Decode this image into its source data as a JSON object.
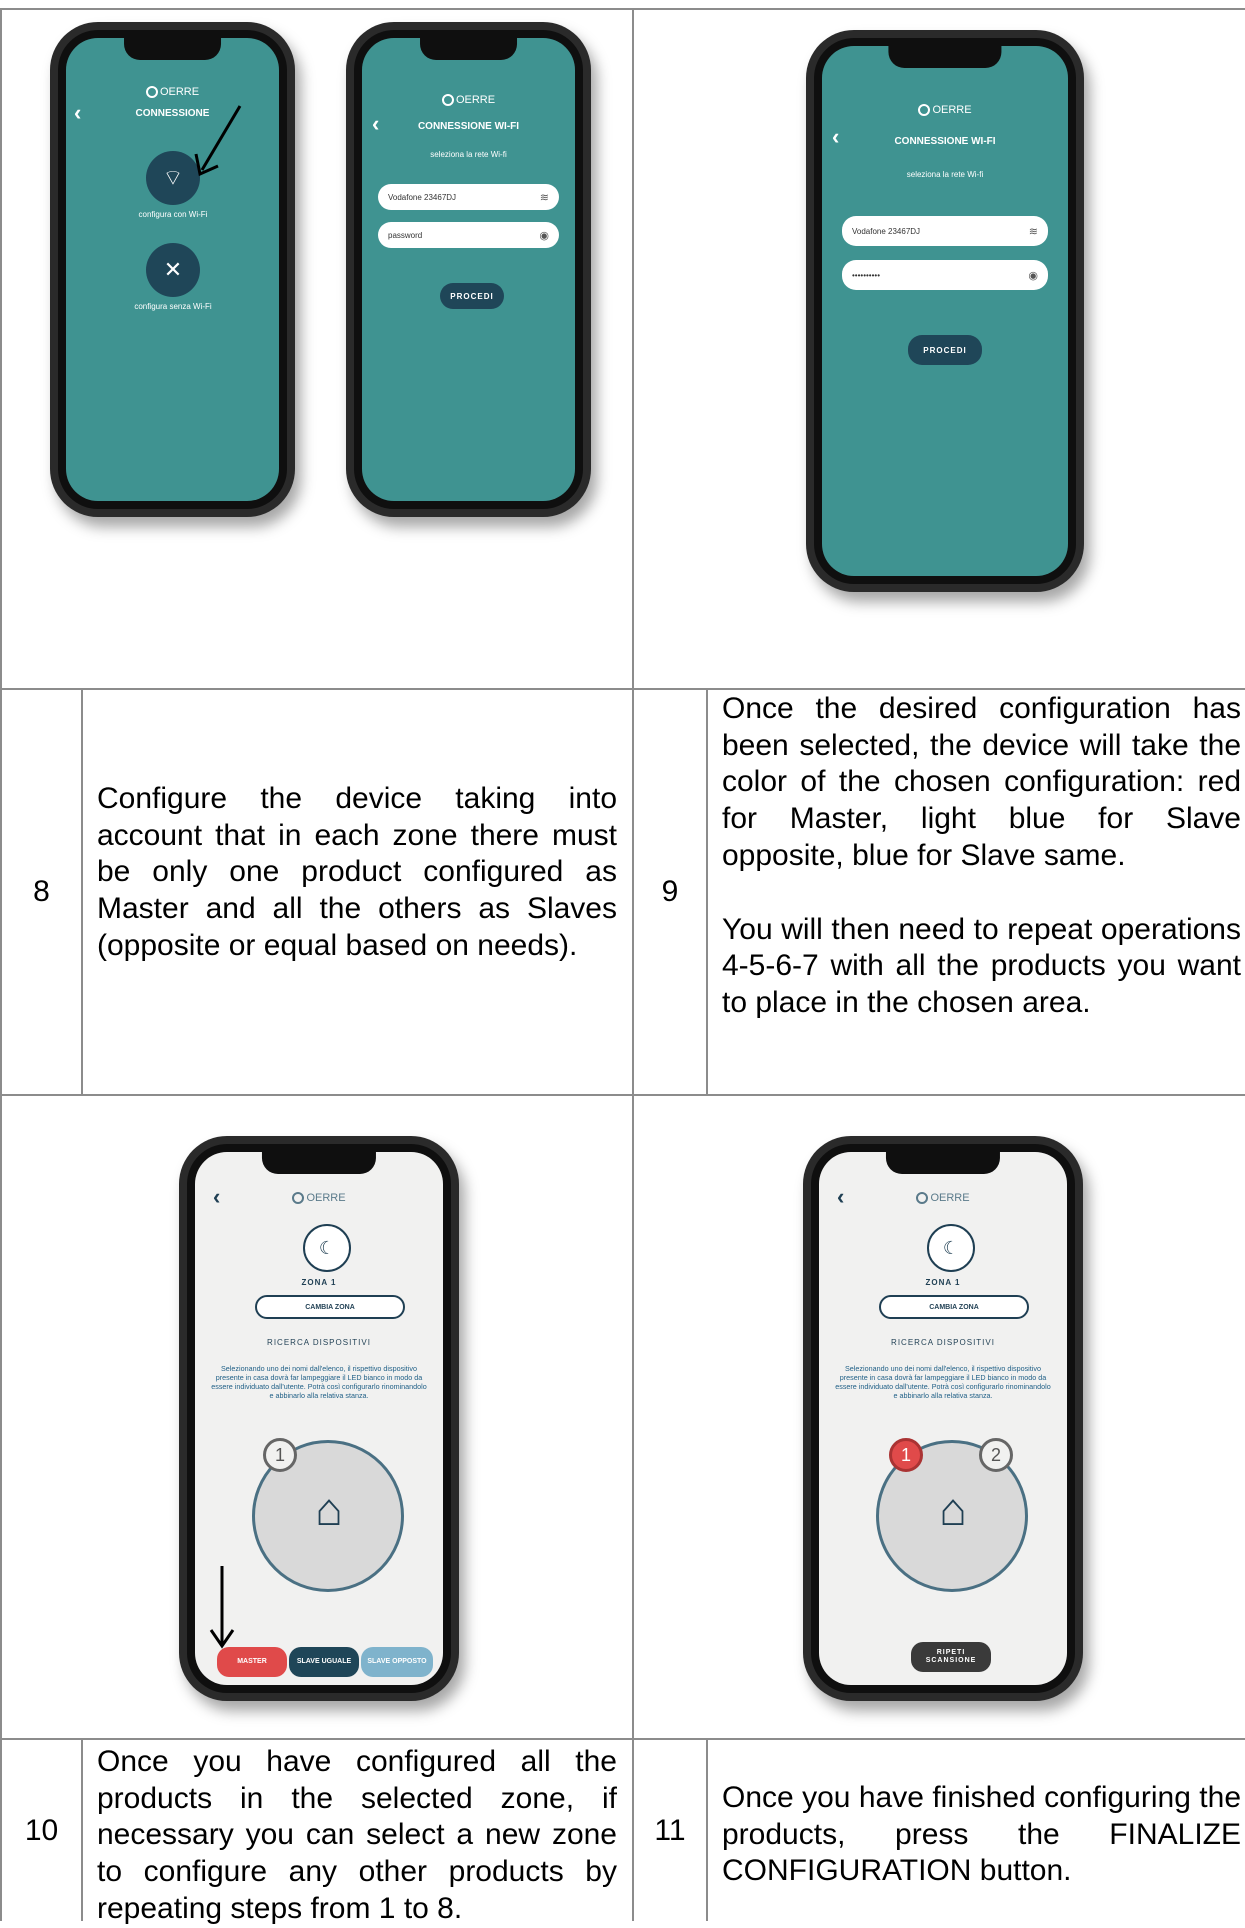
{
  "rows": [
    {
      "left": {
        "phones": [
          {
            "brand": "OERRE",
            "title": "CONNESSIONE",
            "option1": "configura con Wi-Fi",
            "option2": "configura senza Wi-Fi"
          },
          {
            "brand": "OERRE",
            "title": "CONNESSIONE WI-FI",
            "subtitle": "seleziona la rete Wi-fi",
            "network": "Vodafone 23467DJ",
            "password_placeholder": "password",
            "button": "PROCEDI"
          }
        ]
      },
      "right": {
        "phone": {
          "brand": "OERRE",
          "title": "CONNESSIONE WI-FI",
          "subtitle": "seleziona la rete Wi-fi",
          "network": "Vodafone 23467DJ",
          "password_value": "••••••••••",
          "button": "PROCEDI"
        }
      }
    }
  ],
  "steps": {
    "s8": {
      "number": "8",
      "text": "Configure the device taking into account that in each zone there must be only one product configured as Master and all the others as Slaves (opposite or equal based on needs)."
    },
    "s9": {
      "number": "9",
      "text1": "Once the desired configuration has been selected, the device will take the color of the chosen configuration: red for Master, light blue for Slave opposite, blue for Slave same.",
      "text2": "You will then need to repeat operations 4-5-6-7 with all the products you want to place in the chosen area."
    },
    "s10": {
      "number": "10",
      "text": "Once you have configured all the products in the selected zone, if necessary you can select a new zone to configure any other products by repeating steps from 1 to 8."
    },
    "s11": {
      "number": "11",
      "text": "Once you have finished configuring the products, press the FINALIZE CONFIGURATION button."
    }
  },
  "zone_phones": {
    "left": {
      "brand": "OERRE",
      "zone": "ZONA 1",
      "change_zone": "CAMBIA ZONA",
      "search_title": "RICERCA DISPOSITIVI",
      "description": "Selezionando uno dei nomi dall'elenco, il rispettivo dispositivo presente in casa dovrà far lampeggiare il LED bianco in modo da essere individuato dall'utente. Potrà così configurarlo rinominandolo e abbinarlo alla relativa stanza.",
      "badge1": "1",
      "btn_master": "MASTER",
      "btn_slave_same": "SLAVE UGUALE",
      "btn_slave_opposite": "SLAVE OPPOSTO"
    },
    "right": {
      "brand": "OERRE",
      "zone": "ZONA 1",
      "change_zone": "CAMBIA ZONA",
      "search_title": "RICERCA DISPOSITIVI",
      "description": "Selezionando uno dei nomi dall'elenco, il rispettivo dispositivo presente in casa dovrà far lampeggiare il LED bianco in modo da essere individuato dall'utente. Potrà così configurarlo rinominandolo e abbinarlo alla relativa stanza.",
      "badge1": "1",
      "badge2": "2",
      "btn_rescan": "RIPETI SCANSIONE"
    }
  },
  "colors": {
    "teal_screen": "#3f9391",
    "dark_button": "#1f4658",
    "master_red": "#e04a4a",
    "slave_opposite": "#7fb3cc",
    "grid_line": "#8c8c8c"
  }
}
